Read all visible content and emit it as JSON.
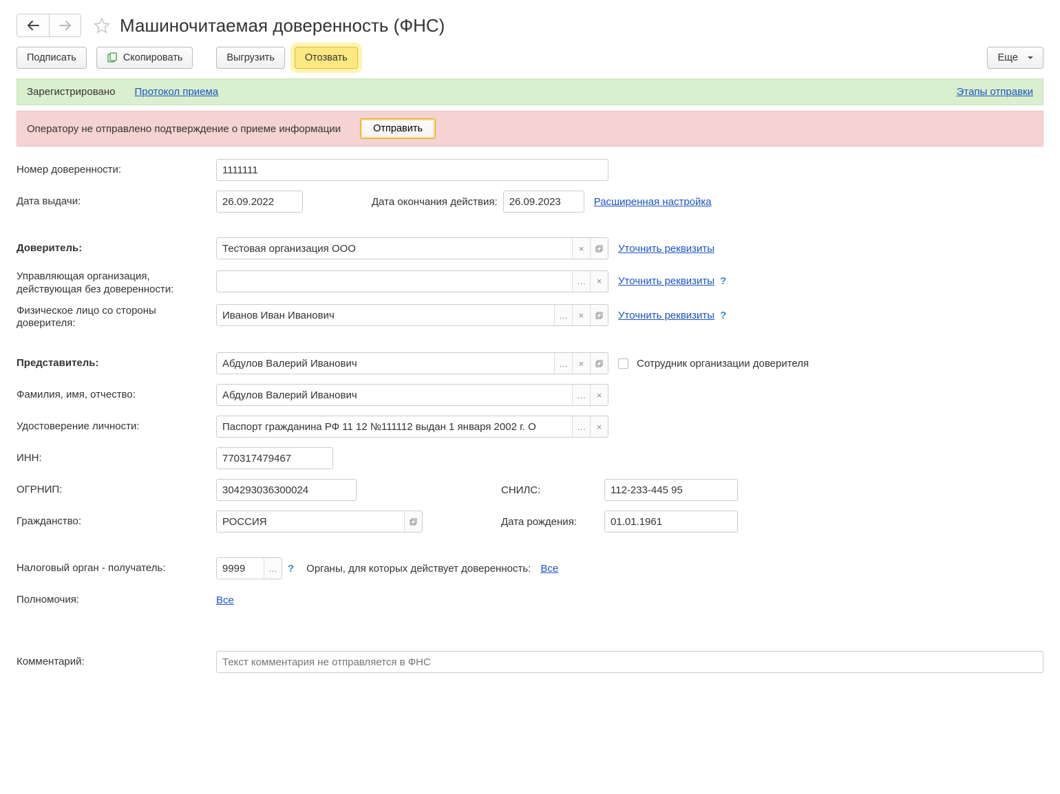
{
  "header": {
    "title": "Машиночитаемая доверенность (ФНС)"
  },
  "toolbar": {
    "sign": "Подписать",
    "copy": "Скопировать",
    "export": "Выгрузить",
    "revoke": "Отозвать",
    "more": "Еще"
  },
  "statusBanner": {
    "status": "Зарегистрировано",
    "protocolLink": "Протокол приема",
    "stagesLink": "Этапы отправки"
  },
  "errorBanner": {
    "text": "Оператору не отправлено подтверждение о приеме информации",
    "action": "Отправить"
  },
  "form": {
    "numberLabel": "Номер доверенности:",
    "numberValue": "1111111",
    "issueDateLabel": "Дата выдачи:",
    "issueDateValue": "26.09.2022",
    "endDateLabel": "Дата окончания действия:",
    "endDateValue": "26.09.2023",
    "advancedLink": "Расширенная настройка",
    "principalLabel": "Доверитель:",
    "principalValue": "Тестовая организация ООО",
    "clarifyLink": "Уточнить реквизиты",
    "mgmtOrgLabel": "Управляющая организация, действующая без доверенности:",
    "mgmtOrgValue": "",
    "principalPersonLabel": "Физическое лицо со стороны доверителя:",
    "principalPersonValue": "Иванов Иван Иванович",
    "repLabel": "Представитель:",
    "repValue": "Абдулов Валерий Иванович",
    "repEmployeeLabel": "Сотрудник организации доверителя",
    "fioLabel": "Фамилия, имя, отчество:",
    "fioValue": "Абдулов Валерий Иванович",
    "idDocLabel": "Удостоверение личности:",
    "idDocValue": "Паспорт гражданина РФ 11 12 №111112 выдан 1 января 2002 г. О",
    "innLabel": "ИНН:",
    "innValue": "770317479467",
    "ogrnipLabel": "ОГРНИП:",
    "ogrnipValue": "304293036300024",
    "snilsLabel": "СНИЛС:",
    "snilsValue": "112-233-445 95",
    "citizenLabel": "Гражданство:",
    "citizenValue": "РОССИЯ",
    "dobLabel": "Дата рождения:",
    "dobValue": "01.01.1961",
    "taxOrgLabel": "Налоговый орган - получатель:",
    "taxOrgValue": "9999",
    "taxOrgScopeLabel": "Органы, для которых действует доверенность:",
    "allLink": "Все",
    "powersLabel": "Полномочия:",
    "commentLabel": "Комментарий:",
    "commentPlaceholder": "Текст комментария не отправляется в ФНС"
  }
}
